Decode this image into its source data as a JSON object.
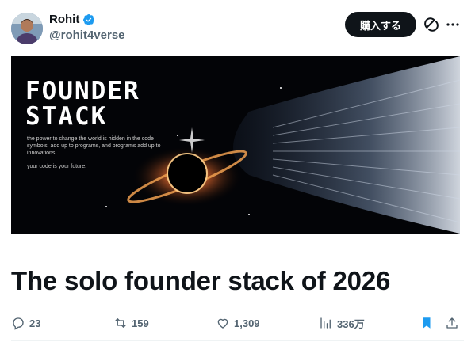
{
  "user": {
    "name": "Rohit",
    "handle": "@rohit4verse",
    "verified": true
  },
  "header": {
    "buy_label": "購入する"
  },
  "icons": {
    "grok": "grok-icon",
    "more": "more-icon",
    "verified": "verified-badge-icon"
  },
  "banner": {
    "title_line1": "FOUNDER",
    "title_line2": "STACK",
    "text": "the power to change the world is hidden in the code symbols, add up to programs, and programs add up to innovations.",
    "subtext": "your code is your future."
  },
  "post": {
    "title": "The solo founder stack of 2026"
  },
  "actions": {
    "replies": "23",
    "reposts": "159",
    "likes": "1,309",
    "views": "336万"
  },
  "colors": {
    "text": "#0f1419",
    "secondary": "#536471",
    "accent": "#1d9bf0",
    "button_bg": "#0f1419"
  }
}
